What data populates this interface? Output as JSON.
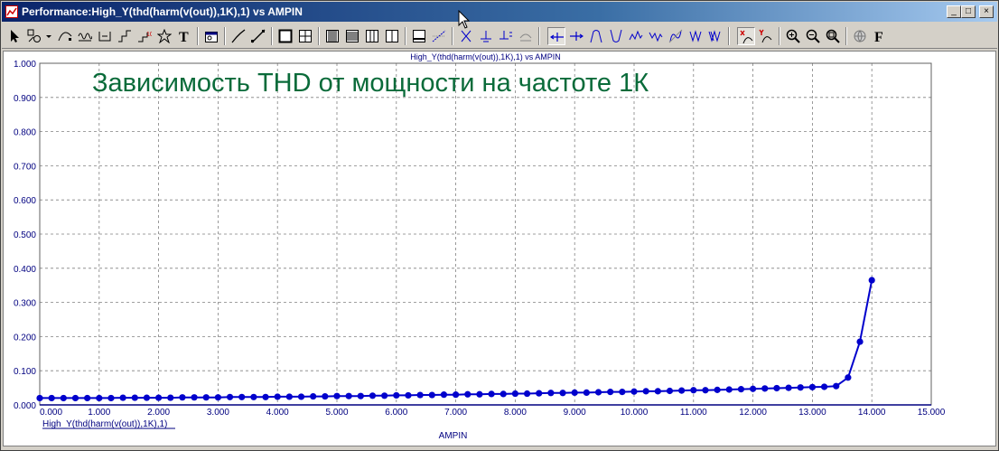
{
  "window": {
    "title": "Performance:High_Y(thd(harm(v(out)),1K),1) vs AMPIN",
    "minimize": "_",
    "maximize": "□",
    "close": "×"
  },
  "toolbar": {
    "icons": [
      "select-arrow-icon",
      "select-shapes-icon",
      "dropdown-arrow-icon",
      "spline-icon",
      "wave-icon",
      "box-icon",
      "step-icon",
      "marker-icon",
      "star-icon",
      "text-tool-icon",
      "properties-icon",
      "linear-icon",
      "log-icon",
      "single-plot-icon",
      "grid-plot-icon",
      "grid-bold-icon",
      "grid-medium-icon",
      "grid-light-icon",
      "grid-none-icon",
      "tile-icon",
      "minor-grid-icon",
      "cursor-x-icon",
      "cursor-y-icon",
      "cursor-xy-icon",
      "cursor-step-icon",
      "peak-left-icon",
      "peak-right-icon",
      "peak-icon",
      "valley-icon",
      "high-icon",
      "low-icon",
      "inflection-icon",
      "slope-icon",
      "valleys-icon",
      "tag-x-icon",
      "tag-y-icon",
      "zoom-in-icon",
      "zoom-out-icon",
      "zoom-fit-icon",
      "globe-icon",
      "font-icon"
    ],
    "font_glyph": "F",
    "text_glyph": "T"
  },
  "plot": {
    "subtitle": "High_Y(thd(harm(v(out)),1K),1) vs AMPIN",
    "annotation": "Зависимость THD от мощности на частоте 1К",
    "legend": "High_Y(thd(harm(v(out)),1K),1)",
    "colors": {
      "line": "#0000cc",
      "axis": "#000080",
      "grid": "#808080",
      "annotation": "#0a6b3a"
    }
  },
  "chart_data": {
    "type": "line",
    "title": "High_Y(thd(harm(v(out)),1K),1) vs AMPIN",
    "xlabel": "AMPIN",
    "ylabel": "",
    "xlim": [
      0,
      15
    ],
    "ylim": [
      0,
      1
    ],
    "grid": true,
    "x_ticks": [
      "0.000",
      "1.000",
      "2.000",
      "3.000",
      "4.000",
      "5.000",
      "6.000",
      "7.000",
      "8.000",
      "9.000",
      "10.000",
      "11.000",
      "12.000",
      "13.000",
      "14.000",
      "15.000"
    ],
    "y_ticks": [
      "0.000",
      "0.100",
      "0.200",
      "0.300",
      "0.400",
      "0.500",
      "0.600",
      "0.700",
      "0.800",
      "0.900",
      "1.000"
    ],
    "series": [
      {
        "name": "High_Y(thd(harm(v(out)),1K),1)",
        "x": [
          0.0,
          0.2,
          0.4,
          0.6,
          0.8,
          1.0,
          1.2,
          1.4,
          1.6,
          1.8,
          2.0,
          2.2,
          2.4,
          2.6,
          2.8,
          3.0,
          3.2,
          3.4,
          3.6,
          3.8,
          4.0,
          4.2,
          4.4,
          4.6,
          4.8,
          5.0,
          5.2,
          5.4,
          5.6,
          5.8,
          6.0,
          6.2,
          6.4,
          6.6,
          6.8,
          7.0,
          7.2,
          7.4,
          7.6,
          7.8,
          8.0,
          8.2,
          8.4,
          8.6,
          8.8,
          9.0,
          9.2,
          9.4,
          9.6,
          9.8,
          10.0,
          10.2,
          10.4,
          10.6,
          10.8,
          11.0,
          11.2,
          11.4,
          11.6,
          11.8,
          12.0,
          12.2,
          12.4,
          12.6,
          12.8,
          13.0,
          13.2,
          13.4,
          13.6,
          13.8,
          14.0
        ],
        "y": [
          0.02,
          0.02,
          0.02,
          0.02,
          0.02,
          0.02,
          0.02,
          0.021,
          0.021,
          0.021,
          0.021,
          0.021,
          0.022,
          0.022,
          0.022,
          0.022,
          0.023,
          0.023,
          0.023,
          0.023,
          0.024,
          0.024,
          0.024,
          0.025,
          0.025,
          0.026,
          0.026,
          0.026,
          0.027,
          0.027,
          0.028,
          0.028,
          0.029,
          0.029,
          0.03,
          0.03,
          0.031,
          0.031,
          0.032,
          0.032,
          0.033,
          0.033,
          0.034,
          0.035,
          0.035,
          0.036,
          0.036,
          0.037,
          0.038,
          0.038,
          0.039,
          0.04,
          0.04,
          0.041,
          0.042,
          0.043,
          0.043,
          0.044,
          0.045,
          0.046,
          0.047,
          0.048,
          0.049,
          0.05,
          0.051,
          0.052,
          0.053,
          0.055,
          0.08,
          0.185,
          0.365
        ]
      }
    ]
  }
}
